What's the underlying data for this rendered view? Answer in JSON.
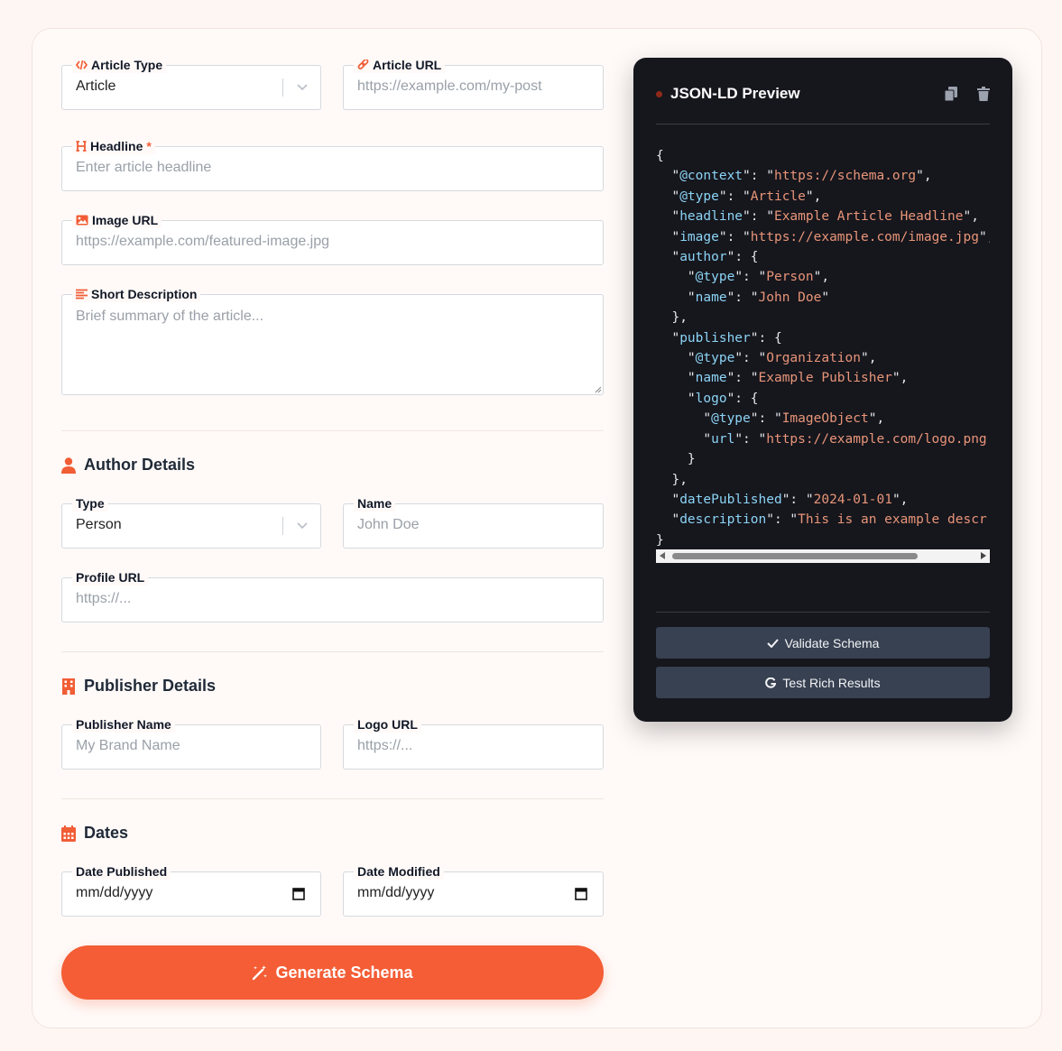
{
  "form": {
    "article_type": {
      "label": "Article Type",
      "value": "Article"
    },
    "article_url": {
      "label": "Article URL",
      "placeholder": "https://example.com/my-post"
    },
    "headline": {
      "label": "Headline",
      "required_mark": "*",
      "placeholder": "Enter article headline"
    },
    "image_url": {
      "label": "Image URL",
      "placeholder": "https://example.com/featured-image.jpg"
    },
    "description": {
      "label": "Short Description",
      "placeholder": "Brief summary of the article..."
    }
  },
  "author": {
    "title": "Author Details",
    "type": {
      "label": "Type",
      "value": "Person"
    },
    "name": {
      "label": "Name",
      "placeholder": "John Doe"
    },
    "profile_url": {
      "label": "Profile URL",
      "placeholder": "https://..."
    }
  },
  "publisher": {
    "title": "Publisher Details",
    "name": {
      "label": "Publisher Name",
      "placeholder": "My Brand Name"
    },
    "logo_url": {
      "label": "Logo URL",
      "placeholder": "https://..."
    }
  },
  "dates": {
    "title": "Dates",
    "published": {
      "label": "Date Published",
      "placeholder": "mm/dd/yyyy"
    },
    "modified": {
      "label": "Date Modified",
      "placeholder": "mm/dd/yyyy"
    }
  },
  "generate_button": "Generate Schema",
  "preview": {
    "title": "JSON-LD Preview",
    "validate_button": "Validate Schema",
    "test_button": "Test Rich Results",
    "json": {
      "context": "https://schema.org",
      "type": "Article",
      "headline": "Example Article Headline",
      "image": "https://example.com/image.jpg",
      "author_type": "Person",
      "author_name": "John Doe",
      "publisher_type": "Organization",
      "publisher_name": "Example Publisher",
      "logo_type": "ImageObject",
      "logo_url": "https://example.com/logo.png",
      "date_published": "2024-01-01",
      "description": "This is an example descr"
    }
  },
  "colors": {
    "accent": "#f45d35",
    "panel_bg": "#16161d",
    "json_key": "#8bd4f5",
    "json_string": "#e89578"
  }
}
